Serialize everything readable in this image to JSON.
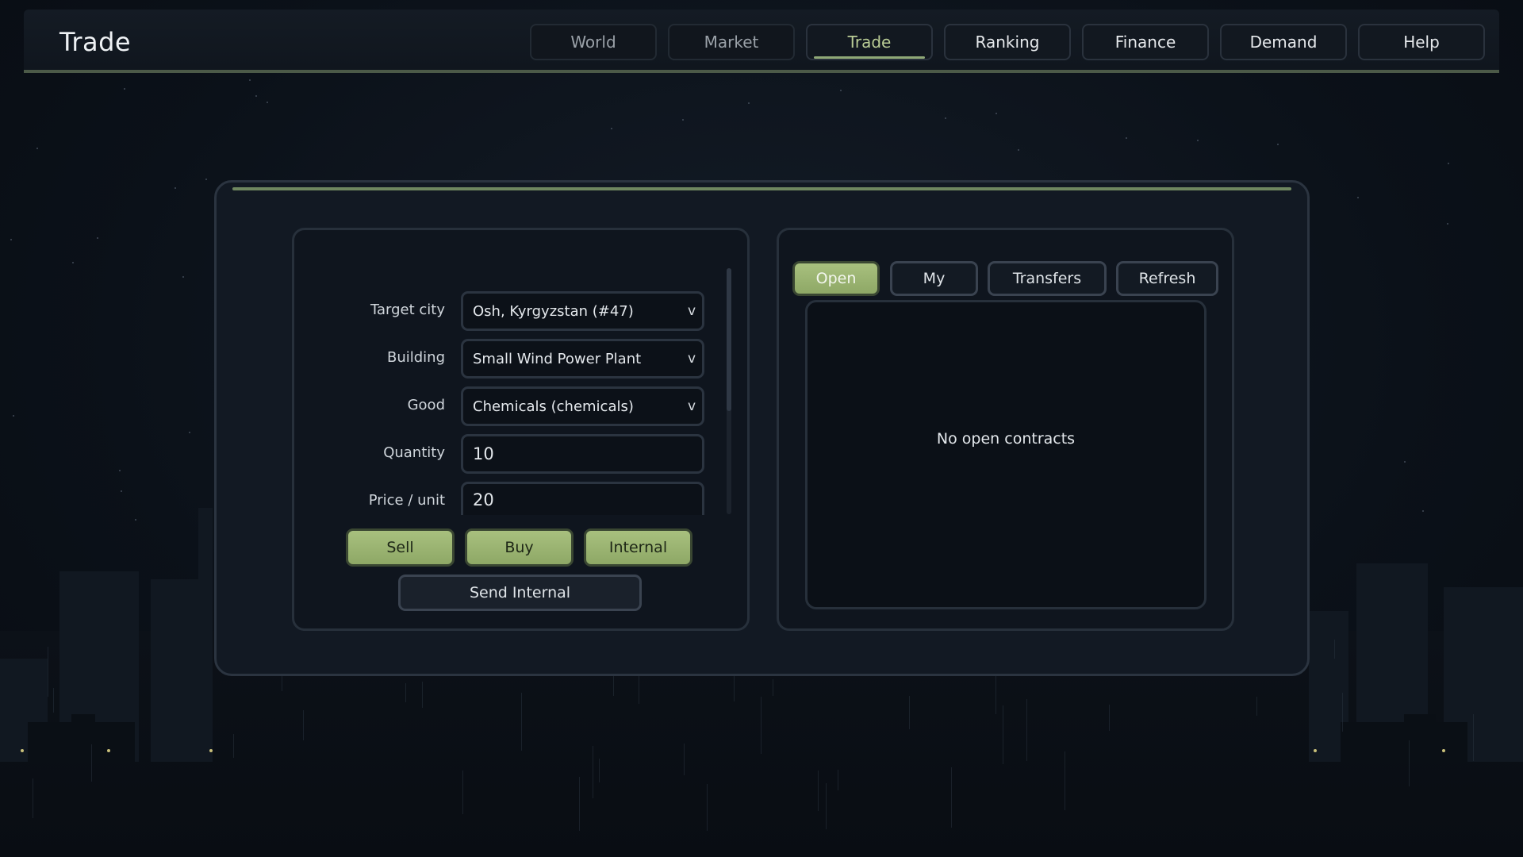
{
  "header": {
    "title": "Trade",
    "nav": [
      {
        "label": "World"
      },
      {
        "label": "Market"
      },
      {
        "label": "Trade"
      },
      {
        "label": "Ranking"
      },
      {
        "label": "Finance"
      },
      {
        "label": "Demand"
      },
      {
        "label": "Help"
      }
    ],
    "active_tab": "Trade"
  },
  "form": {
    "target_city": {
      "label": "Target city",
      "value": "Osh, Kyrgyzstan (#47)"
    },
    "building": {
      "label": "Building",
      "value": "Small Wind Power Plant"
    },
    "good": {
      "label": "Good",
      "value": "Chemicals (chemicals)"
    },
    "quantity": {
      "label": "Quantity",
      "value": "10"
    },
    "price": {
      "label": "Price / unit",
      "value": "20"
    },
    "chevron": "v",
    "buttons": {
      "sell": "Sell",
      "buy": "Buy",
      "internal": "Internal",
      "send_internal": "Send Internal"
    }
  },
  "contracts": {
    "tabs": [
      {
        "label": "Open"
      },
      {
        "label": "My"
      },
      {
        "label": "Transfers"
      },
      {
        "label": "Refresh"
      }
    ],
    "active_tab": "Open",
    "empty_message": "No open contracts"
  },
  "colors": {
    "accent_green": "#a8c07e",
    "active_nav_text": "#b9cc95",
    "background": "#0b111a"
  }
}
